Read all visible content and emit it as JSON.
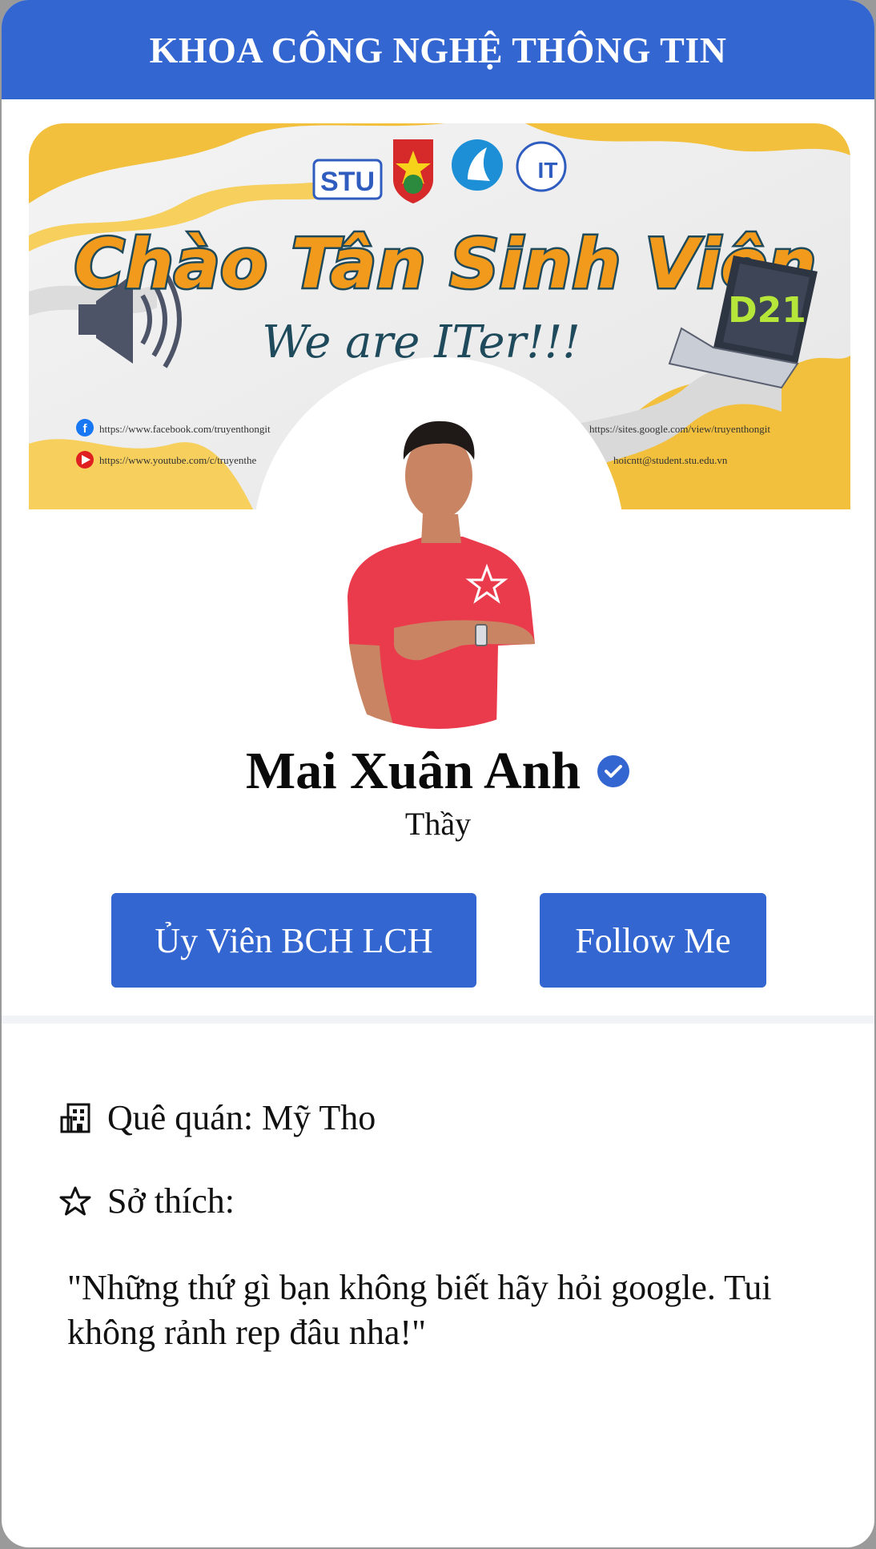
{
  "header": {
    "title": "KHOA CÔNG NGHỆ THÔNG TIN"
  },
  "banner": {
    "logos": [
      "STU",
      "IT"
    ],
    "headline": "Chào Tân Sinh Viên",
    "tagline": "We are ITer!!!",
    "badge": "D21",
    "links": [
      "https://www.facebook.com/truyenthongit",
      "https://www.youtube.com/c/truyenthe",
      "https://sites.google.com/view/truyenthongit",
      "hoicntt@student.stu.edu.vn"
    ]
  },
  "profile": {
    "name": "Mai Xuân Anh",
    "title": "Thầy",
    "verified": true
  },
  "buttons": {
    "role": "Ủy Viên BCH LCH",
    "follow": "Follow Me"
  },
  "details": {
    "hometown_label": "Quê quán: Mỹ Tho",
    "hobby_label": "Sở thích:",
    "quote": "\"Những thứ gì bạn không biết hãy hỏi google. Tui không rảnh rep đâu nha!\""
  },
  "colors": {
    "accent": "#3366d1",
    "background": "#ffffff",
    "banner_yellow": "#f2c03c",
    "banner_orange": "#f29a1c",
    "banner_teal": "#1e4a5c",
    "shirt_red": "#ea3b4c"
  },
  "icons": {
    "verified": "verified-badge-icon",
    "hometown": "building-icon",
    "hobby": "star-icon",
    "megaphone": "megaphone-icon",
    "laptop": "laptop-icon"
  }
}
